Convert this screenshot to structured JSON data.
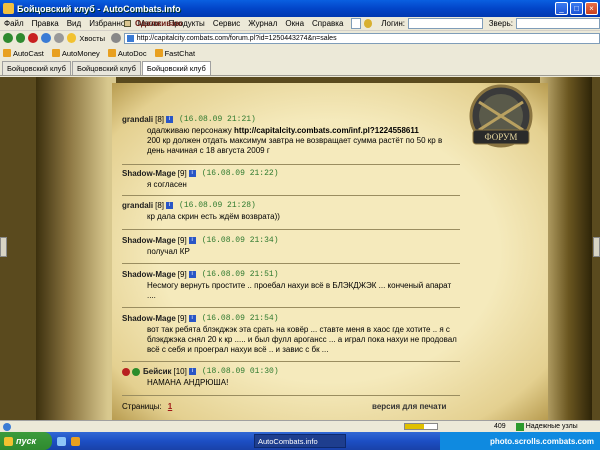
{
  "window": {
    "title": "Бойцовский клуб - AutoCombats.info"
  },
  "menu": {
    "items": [
      "Файл",
      "Правка",
      "Вид",
      "Избранное",
      "Магия",
      "Продукты",
      "Сервис",
      "Журнал",
      "Окна",
      "Справка"
    ],
    "login_label": "Логин:",
    "beast_label": "Зверь:"
  },
  "toolbar": {
    "bookmarks_label": "Хвосты",
    "address": "http://capitalcity.combats.com/forum.pl?id=1250443274&n=sales"
  },
  "links": [
    "AutoCast",
    "AutoMoney",
    "AutoDoc",
    "FastChat"
  ],
  "tabs": [
    "Бойцовский клуб",
    "Бойцовский клуб",
    "Бойцовский клуб"
  ],
  "colors": {
    "accent": "#6b1a12",
    "date_green": "#2f7a2f"
  },
  "forum": {
    "topic_title": "Одалживаю",
    "posts": [
      {
        "author": "grandali",
        "level": "[8]",
        "date": "(16.08.09 21:21)",
        "line1_text": "одалживаю персонажу ",
        "line1_url": "http://capitalcity.combats.com/inf.pl?1224558611",
        "body_rest": "200 кр должен отдать максимум завтра не возвращает сумма растёт по 50 кр в день начиная с 18 августа 2009 г"
      },
      {
        "author": "Shadow-Mage",
        "level": "[9]",
        "date": "(16.08.09 21:22)",
        "body": "я согласен"
      },
      {
        "author": "grandali",
        "level": "[8]",
        "date": "(16.08.09 21:28)",
        "body": "кр дала скрин есть ждём возврата))"
      },
      {
        "author": "Shadow-Mage",
        "level": "[9]",
        "date": "(16.08.09 21:34)",
        "body": "получал КР"
      },
      {
        "author": "Shadow-Mage",
        "level": "[9]",
        "date": "(16.08.09 21:51)",
        "body": "Несмогу вернуть простите .. проебал нахуи всё в БЛЭКДЖЭК ... конченый апарат ...."
      },
      {
        "author": "Shadow-Mage",
        "level": "[9]",
        "date": "(16.08.09 21:54)",
        "body": "вот так ребята блэкджэк эта срать на ковёр ... ставте меня в хаос где хотите .. я с блэкджэка снял 20 к кр ..... и был фулл арогансс ... а играл пока нахуи не продовал всё с себя и проеграл нахуи всё .. и завис с бк ..."
      },
      {
        "author": "Бейсик",
        "level": "[10]",
        "date": "(18.08.09 01:30)",
        "body": "НАМАНА АНДРЮША!"
      }
    ],
    "pages_label": "Страницы:",
    "page_number": "1",
    "print_label": "версия для печати"
  },
  "status": {
    "progress_fraction": 0.6,
    "count": "409",
    "zone": "Надежные узлы"
  },
  "taskbar": {
    "start_label": "пуск",
    "task_label": "AutoCombats.info",
    "tray_text": "photo.scrolls.combats.com"
  }
}
